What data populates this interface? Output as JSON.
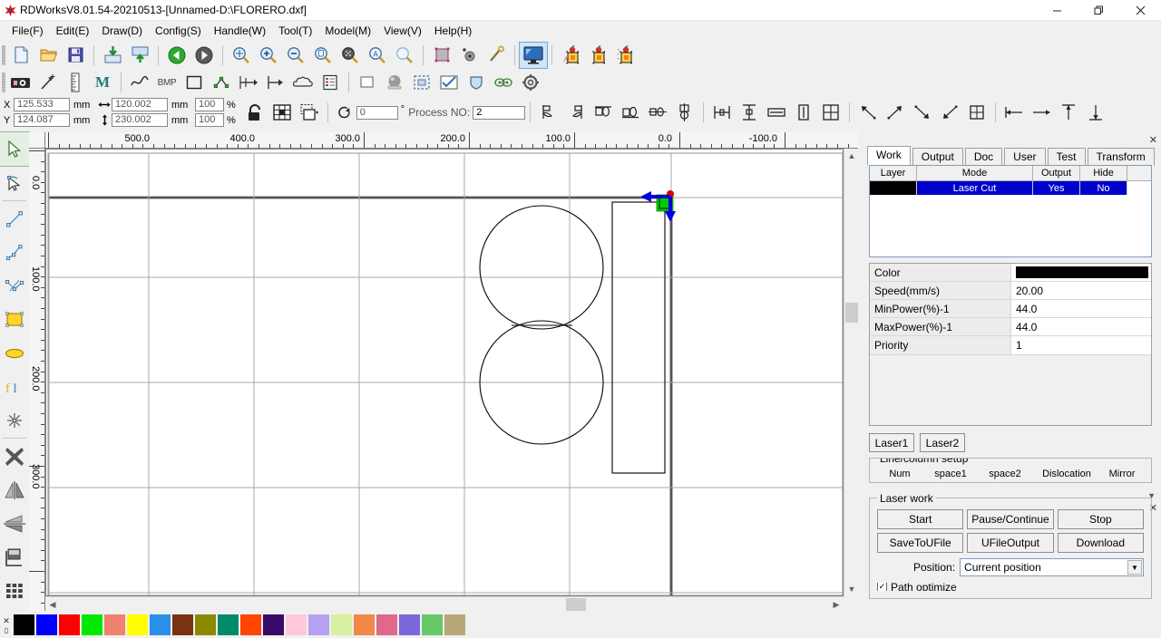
{
  "window": {
    "title": "RDWorksV8.01.54-20210513-[Unnamed-D:\\FLORERO.dxf]",
    "app_icon": "rdworks-logo-icon",
    "minimize": "—",
    "restore": "❐",
    "close": "✕"
  },
  "menu": [
    {
      "label": "File(F)",
      "name": "menu-file"
    },
    {
      "label": "Edit(E)",
      "name": "menu-edit"
    },
    {
      "label": "Draw(D)",
      "name": "menu-draw"
    },
    {
      "label": "Config(S)",
      "name": "menu-config"
    },
    {
      "label": "Handle(W)",
      "name": "menu-handle"
    },
    {
      "label": "Tool(T)",
      "name": "menu-tool"
    },
    {
      "label": "Model(M)",
      "name": "menu-model"
    },
    {
      "label": "View(V)",
      "name": "menu-view"
    },
    {
      "label": "Help(H)",
      "name": "menu-help"
    }
  ],
  "toolbar_main": {
    "groups": [
      [
        "new-file-icon",
        "open-file-icon",
        "save-file-icon"
      ],
      [
        "import-file-icon",
        "export-file-icon"
      ],
      [
        "undo-icon",
        "redo-icon"
      ],
      [
        "zoom-pan-icon",
        "zoom-in-icon",
        "zoom-out-icon",
        "zoom-page-icon",
        "zoom-selection-icon",
        "zoom-all-icon",
        "zoom-window-icon"
      ],
      [
        "path-optimize-icon",
        "set-origin-icon",
        "cut-optimize-icon"
      ],
      [
        "preview-icon"
      ],
      [
        "array-text-icon",
        "array-copy-icon",
        "array-dup-icon"
      ]
    ]
  },
  "toolbar_second": {
    "groups": [
      [
        "camera-icon",
        "node-arrow-icon",
        "measure-icon",
        "manual-icon"
      ],
      [
        "curve-smooth-icon",
        "bmp-icon",
        "rect-tool-icon",
        "node-merge-icon",
        "offset-poly-icon",
        "seal-icon",
        "cloud-icon",
        "data-check-icon"
      ],
      [
        "frame-icon",
        "ball-icon",
        "dashed-select-icon",
        "check-path-icon",
        "shield-icon",
        "eyes-icon",
        "settings-gear-icon"
      ]
    ]
  },
  "property_bar": {
    "x_label": "X",
    "x_value": "125.533",
    "y_label": "Y",
    "y_value": "124.087",
    "unit": "mm",
    "width_icon": "width-arrow-icon",
    "width_value": "120.002",
    "height_icon": "height-arrow-icon",
    "height_value": "230.002",
    "scale_x": "100",
    "scale_y": "100",
    "percent": "%",
    "lock_icon": "lock-aspect-icon",
    "grid_icon": "anchor-grid-icon",
    "copy_icon": "duplicate-icon",
    "rotate_icon": "rotate-icon",
    "rotate_value": "0",
    "degree": "°",
    "process_label": "Process NO:",
    "process_value": "2",
    "align_icons": [
      "align-left-curve-icon",
      "align-right-curve-icon",
      "align-top-icon",
      "align-bottom-icon",
      "align-center-h-icon",
      "align-center-v-icon"
    ],
    "distribute_icons": [
      "dist-horizontal-icon",
      "dist-vertical-icon",
      "size-same-width-icon",
      "size-same-height-icon",
      "size-same-both-icon"
    ],
    "origin_icons": [
      "origin-topleft-icon",
      "origin-topright-icon",
      "origin-bottomright-icon",
      "origin-bottomleft-icon",
      "origin-center-icon"
    ],
    "measure_icons": [
      "measure-left-icon",
      "measure-right-icon",
      "measure-top-icon",
      "measure-bottom-icon"
    ]
  },
  "tool_palette": [
    {
      "name": "select-tool",
      "icon": "arrow-cursor-icon",
      "active": true
    },
    {
      "name": "node-edit-tool",
      "icon": "node-edit-icon",
      "active": false
    },
    {
      "name": "line-tool",
      "icon": "line-icon",
      "active": false
    },
    {
      "name": "polyline-tool",
      "icon": "polyline-icon",
      "active": false
    },
    {
      "name": "bezier-tool",
      "icon": "bezier-curve-icon",
      "active": false
    },
    {
      "name": "rectangle-tool",
      "icon": "rectangle-icon",
      "active": false
    },
    {
      "name": "ellipse-tool",
      "icon": "ellipse-icon",
      "active": false
    },
    {
      "name": "text-tool",
      "icon": "text-icon",
      "active": false
    },
    {
      "name": "point-tool",
      "icon": "star-point-icon",
      "active": false
    },
    {
      "name": "delete-tool",
      "icon": "delete-x-icon",
      "active": false
    },
    {
      "name": "mirror-vertical-tool",
      "icon": "mirror-vertical-icon",
      "active": false
    },
    {
      "name": "mirror-horizontal-tool",
      "icon": "mirror-horizontal-icon",
      "active": false
    },
    {
      "name": "offset-tool",
      "icon": "offset-shape-icon",
      "active": false
    },
    {
      "name": "array-tool",
      "icon": "grid-array-icon",
      "active": false
    }
  ],
  "rulers": {
    "horizontal_labels": [
      "500.0",
      "400.0",
      "300.0",
      "200.0",
      "100.0",
      "0.0",
      "-100.0"
    ],
    "vertical_labels": [
      "0.0",
      "100.0",
      "200.0",
      "300.0"
    ]
  },
  "canvas": {
    "origin_marker": "machine-origin-icon",
    "direction_arrow_left": "arrow-left-icon",
    "direction_arrow_down": "arrow-down-icon",
    "shapes": "two-tangent-circles-and-rectangle"
  },
  "right_panel": {
    "tabs": [
      {
        "label": "Work",
        "selected": true
      },
      {
        "label": "Output",
        "selected": false
      },
      {
        "label": "Doc",
        "selected": false
      },
      {
        "label": "User",
        "selected": false
      },
      {
        "label": "Test",
        "selected": false
      },
      {
        "label": "Transform",
        "selected": false
      }
    ],
    "layer_table": {
      "headers": [
        "Layer",
        "Mode",
        "Output",
        "Hide",
        ""
      ],
      "rows": [
        {
          "layer_color": "#000000",
          "mode": "Laser Cut",
          "output": "Yes",
          "hide": "No",
          "selected": true
        }
      ]
    },
    "params": [
      {
        "key": "Color",
        "value": "",
        "swatch": "#000000"
      },
      {
        "key": "Speed(mm/s)",
        "value": "20.00"
      },
      {
        "key": "MinPower(%)-1",
        "value": "44.0"
      },
      {
        "key": "MaxPower(%)-1",
        "value": "44.0"
      },
      {
        "key": "Priority",
        "value": "1"
      }
    ],
    "laser_buttons": [
      {
        "label": "Laser1",
        "name": "laser1-button"
      },
      {
        "label": "Laser2",
        "name": "laser2-button"
      }
    ],
    "line_column": {
      "title": "Line/column setup",
      "headers": [
        "Num",
        "space1",
        "space2",
        "Dislocation",
        "Mirror"
      ]
    },
    "laser_work": {
      "title": "Laser work",
      "buttons": [
        {
          "label": "Start",
          "name": "start-button"
        },
        {
          "label": "Pause/Continue",
          "name": "pause-continue-button"
        },
        {
          "label": "Stop",
          "name": "stop-button"
        },
        {
          "label": "SaveToUFile",
          "name": "save-to-ufile-button"
        },
        {
          "label": "UFileOutput",
          "name": "ufile-output-button"
        },
        {
          "label": "Download",
          "name": "download-button"
        }
      ],
      "position_label": "Position:",
      "position_value": "Current position",
      "path_optimize_label": "Path optimize",
      "path_optimize_checked": true
    }
  },
  "palette": {
    "close_icon": "✕",
    "colors": [
      "#000000",
      "#0000ff",
      "#ff0000",
      "#00e800",
      "#f08070",
      "#ffff00",
      "#2a8fe8",
      "#7a3310",
      "#8a8a00",
      "#008a6a",
      "#ff4500",
      "#3a0a6a",
      "#ffc8dc",
      "#b8a0f0",
      "#d8f0a0",
      "#f08848",
      "#e06888",
      "#7868d8",
      "#68c868",
      "#b8a878"
    ]
  },
  "colors": {
    "accent_blue": "#0000cc",
    "origin_green": "#00cc00",
    "origin_red": "#dd0000",
    "panel_bg": "#f0f0f0"
  }
}
